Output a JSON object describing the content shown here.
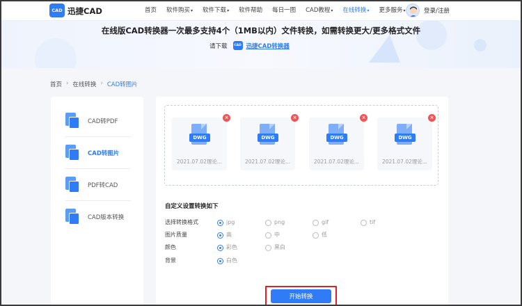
{
  "header": {
    "logo_mark": "CAD",
    "app_name": "迅捷CAD",
    "nav": [
      {
        "label": "首页",
        "caret": false,
        "active": false
      },
      {
        "label": "软件购买",
        "caret": true,
        "active": false
      },
      {
        "label": "软件下载",
        "caret": true,
        "active": false
      },
      {
        "label": "软件帮助",
        "caret": false,
        "active": false
      },
      {
        "label": "每日一图",
        "caret": false,
        "active": false
      },
      {
        "label": "CAD教程",
        "caret": true,
        "active": false
      },
      {
        "label": "在线转换",
        "caret": true,
        "active": true
      },
      {
        "label": "更多服务",
        "caret": true,
        "active": false
      }
    ],
    "login_label": "登录/注册"
  },
  "banner": {
    "title": "在线版CAD转换器一次最多支持4个（1MB以内）文件转换，如需转换更大/更多格式文件",
    "sub_text": "请下载",
    "mini_logo": "CAD",
    "link_label": "迅捷CAD转换器"
  },
  "breadcrumb": [
    "首页",
    "在线转换",
    "CAD转图片"
  ],
  "sidebar": {
    "items": [
      {
        "label": "CAD转PDF",
        "active": false
      },
      {
        "label": "CAD转图片",
        "active": true
      },
      {
        "label": "PDF转CAD",
        "active": false
      },
      {
        "label": "CAD版本转换",
        "active": false
      }
    ]
  },
  "files": [
    {
      "type": "DWG",
      "name": "2021.07.02理论..."
    },
    {
      "type": "DWG",
      "name": "2021.07.02理论..."
    },
    {
      "type": "DWG",
      "name": "2021.07.02理论..."
    },
    {
      "type": "DWG",
      "name": "2021.07.02理论..."
    }
  ],
  "settings": {
    "title": "自定义设置转换如下",
    "rows": [
      {
        "label": "选择转换格式",
        "options": [
          "jpg",
          "png",
          "gif",
          "tif"
        ],
        "selected": 0
      },
      {
        "label": "图片质量",
        "options": [
          "高",
          "中",
          "低"
        ],
        "selected": 0
      },
      {
        "label": "颜色",
        "options": [
          "彩色",
          "黑白"
        ],
        "selected": 0
      },
      {
        "label": "背景",
        "options": [
          "白色"
        ],
        "selected": 0
      }
    ]
  },
  "start_button": "开始转换",
  "colors": {
    "accent": "#2f7cf6",
    "delete": "#f05454",
    "highlight_border": "#e02020"
  }
}
